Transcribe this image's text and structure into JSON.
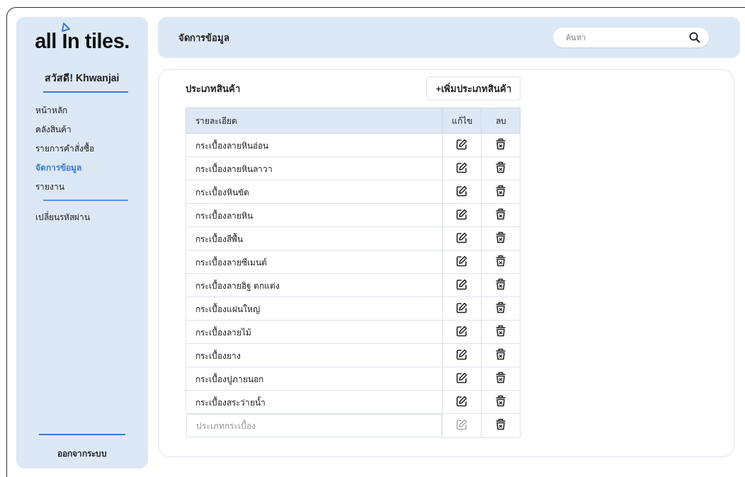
{
  "sidebar": {
    "logo": "all In tiles.",
    "greeting": "สวัสดี! Khwanjai",
    "nav": [
      {
        "label": "หน้าหลัก",
        "selected": false
      },
      {
        "label": "คลังสินค้า",
        "selected": false
      },
      {
        "label": "รายการคำสั่งซื้อ",
        "selected": false
      },
      {
        "label": "จัดการข้อมูล",
        "selected": true
      },
      {
        "label": "รายงาน",
        "selected": false
      }
    ],
    "extra_items": [
      {
        "label": "เปลี่ยนรหัสผ่าน",
        "selected": false
      }
    ],
    "logout": "ออกจากระบบ"
  },
  "header": {
    "title": "จัดการข้อมูล",
    "search": {
      "placeholder": "ค้นหา"
    }
  },
  "panel": {
    "title": "ประเภทสินค้า",
    "add_button": "+เพิ่มประเภทสินค้า",
    "table": {
      "columns": [
        "รายละเอียด",
        "แก้ไข",
        "ลบ"
      ],
      "rows": [
        {
          "kind": "item",
          "name": "กระเบื้องลายหินอ่อน"
        },
        {
          "kind": "item",
          "name": "กระเบื้องลายหินลาวา"
        },
        {
          "kind": "item",
          "name": "กระเบื้องหินขัด"
        },
        {
          "kind": "item",
          "name": "กระเบื้องลายหิน"
        },
        {
          "kind": "item",
          "name": "กระเบื้องสีพื้น"
        },
        {
          "kind": "item",
          "name": "กระเบื้องลายซีเมนต์"
        },
        {
          "kind": "item",
          "name": "กระเบื้องลายอิฐ ตกแต่ง"
        },
        {
          "kind": "item",
          "name": "กระเบื้องแผ่นใหญ่"
        },
        {
          "kind": "item",
          "name": "กระเบื้องลายไม้"
        },
        {
          "kind": "item",
          "name": "กระเบื้องยาง"
        },
        {
          "kind": "item",
          "name": "กระเบื้องปูภายนอก"
        },
        {
          "kind": "item",
          "name": "กระเบื้องสระว่ายน้ำ"
        },
        {
          "kind": "new",
          "placeholder": "ประเภทกระเบื้อง"
        }
      ]
    }
  }
}
